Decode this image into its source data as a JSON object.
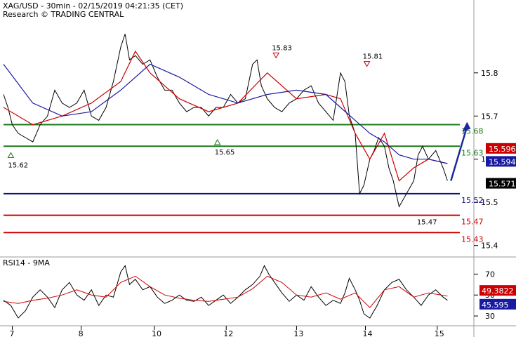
{
  "header": {
    "title": "XAG/USD - 30min - 02/15/2019 04:21:35 (CET)",
    "subtitle": "Research © TRADING CENTRAL"
  },
  "chart_data": [
    {
      "type": "line",
      "panel": "price",
      "title": "XAG/USD - 30min - 02/15/2019 04:21:35 (CET)",
      "ylim": [
        15.38,
        15.92
      ],
      "yticks": [
        15.4,
        15.5,
        15.6,
        15.7,
        15.8
      ],
      "xticks": [
        "7",
        "8",
        "10",
        "12",
        "13",
        "14",
        "15"
      ],
      "xtick_positions": [
        0.6,
        5.3,
        10.3,
        15.2,
        20.0,
        24.7,
        29.6
      ],
      "xlim": [
        0,
        31
      ],
      "series": [
        {
          "x": [
            0,
            0.3,
            0.6,
            1,
            1.5,
            2,
            2.5,
            3,
            3.5,
            4,
            4.5,
            5,
            5.5,
            6,
            6.5,
            7,
            7.5,
            8,
            8.3,
            8.6,
            9,
            9.5,
            10,
            10.5,
            11,
            11.5,
            12,
            12.5,
            13,
            13.5,
            14,
            14.5,
            15,
            15.5,
            16,
            16.5,
            17,
            17.3,
            17.6,
            18,
            18.5,
            19,
            19.5,
            20,
            20.5,
            21,
            21.5,
            22,
            22.5,
            23,
            23.3,
            23.6,
            24,
            24.3,
            24.6,
            25,
            25.3,
            25.6,
            26,
            26.3,
            26.6,
            27,
            27.5,
            28,
            28.3,
            28.6,
            29,
            29.5,
            30,
            30.3
          ],
          "values": [
            15.75,
            15.72,
            15.68,
            15.66,
            15.65,
            15.64,
            15.68,
            15.7,
            15.76,
            15.73,
            15.72,
            15.73,
            15.76,
            15.7,
            15.69,
            15.72,
            15.78,
            15.86,
            15.89,
            15.83,
            15.84,
            15.82,
            15.83,
            15.79,
            15.76,
            15.76,
            15.73,
            15.71,
            15.72,
            15.72,
            15.7,
            15.72,
            15.72,
            15.75,
            15.73,
            15.74,
            15.82,
            15.83,
            15.77,
            15.74,
            15.72,
            15.71,
            15.73,
            15.74,
            15.76,
            15.77,
            15.73,
            15.71,
            15.69,
            15.8,
            15.78,
            15.7,
            15.66,
            15.52,
            15.54,
            15.6,
            15.62,
            15.65,
            15.63,
            15.58,
            15.55,
            15.49,
            15.52,
            15.55,
            15.61,
            15.63,
            15.6,
            15.62,
            15.58,
            15.55
          ]
        },
        {
          "x": [
            0,
            2,
            4,
            6,
            8,
            9,
            10,
            12,
            14,
            16,
            18,
            20,
            22,
            23,
            24,
            25,
            26,
            27,
            28,
            29,
            30.3
          ],
          "values": [
            15.72,
            15.68,
            15.7,
            15.73,
            15.78,
            15.85,
            15.8,
            15.74,
            15.71,
            15.73,
            15.8,
            15.74,
            15.75,
            15.74,
            15.66,
            15.6,
            15.66,
            15.55,
            15.58,
            15.6,
            15.59
          ]
        },
        {
          "x": [
            0,
            2,
            4,
            6,
            8,
            10,
            12,
            14,
            16,
            18,
            20,
            22,
            23,
            24,
            25,
            26,
            27,
            28,
            29,
            30.3
          ],
          "values": [
            15.82,
            15.73,
            15.7,
            15.71,
            15.76,
            15.82,
            15.79,
            15.75,
            15.73,
            15.75,
            15.76,
            15.75,
            15.72,
            15.69,
            15.66,
            15.64,
            15.61,
            15.6,
            15.6,
            15.59
          ]
        }
      ],
      "levels": [
        {
          "label": "15.68",
          "value": 15.68
        },
        {
          "label": "15.63",
          "value": 15.63
        },
        {
          "label": "15.52",
          "value": 15.52
        },
        {
          "label": "15.47",
          "value": 15.47
        },
        {
          "label": "15.43",
          "value": 15.43
        }
      ],
      "markers": [
        {
          "label": "15.62",
          "x": 0.5,
          "value": 15.62,
          "kind": "low"
        },
        {
          "label": "15.65",
          "x": 14.6,
          "value": 15.65,
          "kind": "low"
        },
        {
          "label": "15.83",
          "x": 18.6,
          "value": 15.83,
          "kind": "high"
        },
        {
          "label": "15.81",
          "x": 24.8,
          "value": 15.81,
          "kind": "high"
        },
        {
          "label": "15.47",
          "x": 28.5,
          "value": 15.47,
          "kind": "label"
        }
      ],
      "price_tags": [
        {
          "label": "15.5966",
          "value": 15.5966
        },
        {
          "label": "15.5941",
          "value": 15.5941
        },
        {
          "label": "15.571",
          "value": 15.571
        }
      ],
      "projection_arrow": {
        "from_x": 31.0,
        "from_value": 15.55,
        "to_x": 32.2,
        "to_value": 15.68
      }
    },
    {
      "type": "line",
      "panel": "rsi",
      "title": "RSI14 - 9MA",
      "ylim": [
        22,
        85
      ],
      "yticks": [
        30,
        50,
        70
      ],
      "xlim": [
        0,
        31
      ],
      "series": [
        {
          "x": [
            0,
            0.5,
            1,
            1.5,
            2,
            2.5,
            3,
            3.5,
            4,
            4.5,
            5,
            5.5,
            6,
            6.5,
            7,
            7.5,
            8,
            8.3,
            8.6,
            9,
            9.5,
            10,
            10.5,
            11,
            11.5,
            12,
            12.5,
            13,
            13.5,
            14,
            14.5,
            15,
            15.5,
            16,
            16.5,
            17,
            17.5,
            17.8,
            18.1,
            18.5,
            19,
            19.5,
            20,
            20.5,
            21,
            21.5,
            22,
            22.5,
            23,
            23.3,
            23.6,
            24,
            24.3,
            24.6,
            25,
            25.5,
            26,
            26.5,
            27,
            27.5,
            28,
            28.5,
            29,
            29.5,
            30,
            30.3
          ],
          "values": [
            45,
            40,
            28,
            35,
            48,
            55,
            48,
            38,
            55,
            62,
            50,
            45,
            55,
            40,
            50,
            48,
            72,
            78,
            60,
            65,
            55,
            58,
            48,
            42,
            45,
            50,
            45,
            44,
            48,
            40,
            45,
            50,
            42,
            48,
            55,
            60,
            68,
            78,
            70,
            62,
            52,
            44,
            50,
            45,
            58,
            48,
            40,
            45,
            42,
            52,
            66,
            55,
            45,
            32,
            28,
            40,
            55,
            62,
            65,
            55,
            48,
            40,
            50,
            55,
            48,
            45
          ]
        },
        {
          "x": [
            0,
            1,
            2,
            3,
            4,
            5,
            6,
            7,
            8,
            9,
            10,
            11,
            12,
            13,
            14,
            15,
            16,
            17,
            18,
            19,
            20,
            21,
            22,
            23,
            24,
            25,
            26,
            27,
            28,
            29,
            30.3
          ],
          "values": [
            44,
            42,
            45,
            47,
            50,
            55,
            50,
            48,
            62,
            68,
            58,
            50,
            47,
            45,
            44,
            46,
            48,
            56,
            68,
            62,
            50,
            48,
            52,
            46,
            52,
            38,
            55,
            58,
            48,
            52,
            49
          ]
        }
      ],
      "price_tags": [
        {
          "label": "49.3822",
          "value": 49.3822
        },
        {
          "label": "45.595",
          "value": 45.595
        }
      ]
    }
  ],
  "colors": {
    "price": "#000000",
    "ma_fast": "#cc0000",
    "ma_slow": "#1a1aa0",
    "resistance_green": "#1a7a1a",
    "support_blue": "#101080",
    "support_red": "#cc0000",
    "tag_red": "#cc0000",
    "tag_blue": "#1a1aa0",
    "tag_black": "#000000"
  }
}
